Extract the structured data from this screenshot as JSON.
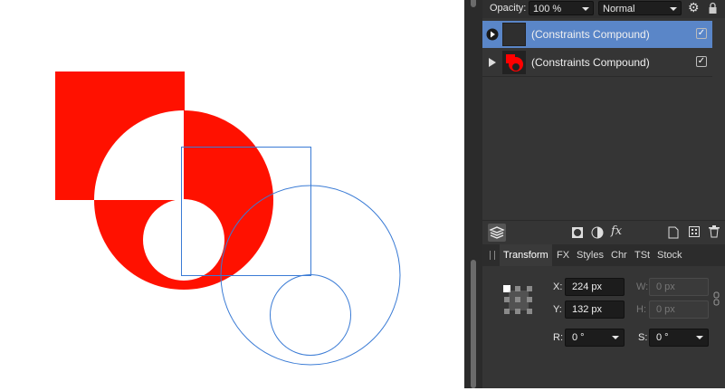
{
  "colors": {
    "shape_red": "#ff1100",
    "selection_blue": "#3a7bd5",
    "panel_bg": "#353535",
    "selected_row": "#5a86c8"
  },
  "toolbar": {
    "opacity_label": "Opacity:",
    "opacity_value": "100 %",
    "blend_mode": "Normal"
  },
  "layers": [
    {
      "name": "(Constraints Compound)",
      "selected": true,
      "checked": true
    },
    {
      "name": "(Constraints Compound)",
      "selected": false,
      "checked": true
    }
  ],
  "icon_row": {
    "fx_label": "fx"
  },
  "tabs": [
    "Transform",
    "FX",
    "Styles",
    "Chr",
    "TSt",
    "Stock"
  ],
  "transform": {
    "x_label": "X:",
    "x_value": "224 px",
    "y_label": "Y:",
    "y_value": "132 px",
    "w_label": "W:",
    "w_value": "0 px",
    "h_label": "H:",
    "h_value": "0 px",
    "r_label": "R:",
    "r_value": "0 °",
    "s_label": "S:",
    "s_value": "0 °"
  }
}
